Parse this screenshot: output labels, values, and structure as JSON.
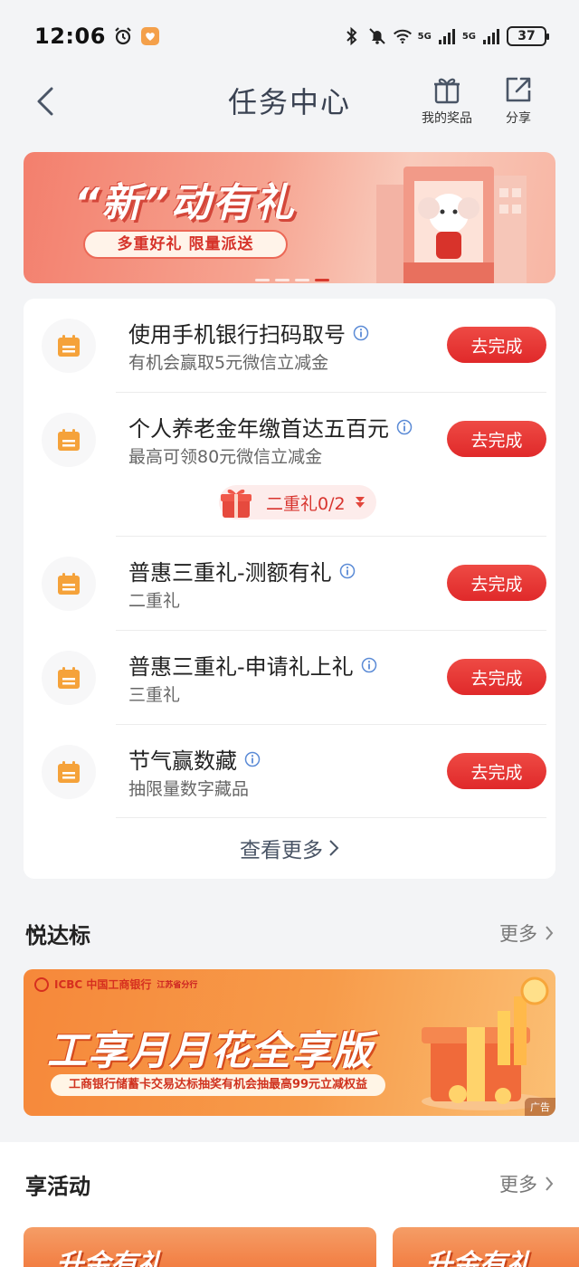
{
  "status_bar": {
    "time": "12:06",
    "battery": "37",
    "network_1": "5G",
    "network_2": "5G"
  },
  "nav": {
    "title": "任务中心",
    "prizes_label": "我的奖品",
    "share_label": "分享"
  },
  "banner": {
    "title": "“新”动有礼",
    "pill": "多重好礼 限量派送"
  },
  "tasks": [
    {
      "title": "使用手机银行扫码取号",
      "sub": "有机会赢取5元微信立减金",
      "button": "去完成"
    },
    {
      "title": "个人养老金年缴首达五百元",
      "sub": "最高可领80元微信立减金",
      "button": "去完成",
      "gift": "二重礼0/2"
    },
    {
      "title": "普惠三重礼-测额有礼",
      "sub": "二重礼",
      "button": "去完成"
    },
    {
      "title": "普惠三重礼-申请礼上礼",
      "sub": "三重礼",
      "button": "去完成"
    },
    {
      "title": "节气赢数藏",
      "sub": "抽限量数字藏品",
      "button": "去完成"
    }
  ],
  "see_more": "查看更多",
  "section_yue": {
    "title": "悦达标",
    "more": "更多"
  },
  "ad": {
    "logo": "ICBC 中国工商银行",
    "logo_sub": "江苏省分行",
    "title": "工享月月花全享版",
    "strip": "工商银行储蓄卡交易达标抽奖有机会抽最高99元立减权益",
    "tag": "广告"
  },
  "section_act": {
    "title": "享活动",
    "more": "更多"
  },
  "activity_cards": [
    {
      "title": "升金有礼"
    },
    {
      "title": "升金有礼"
    }
  ],
  "colors": {
    "accent_red": "#e0292a",
    "task_icon": "#f5a23a",
    "info_icon": "#5b8bd6"
  }
}
